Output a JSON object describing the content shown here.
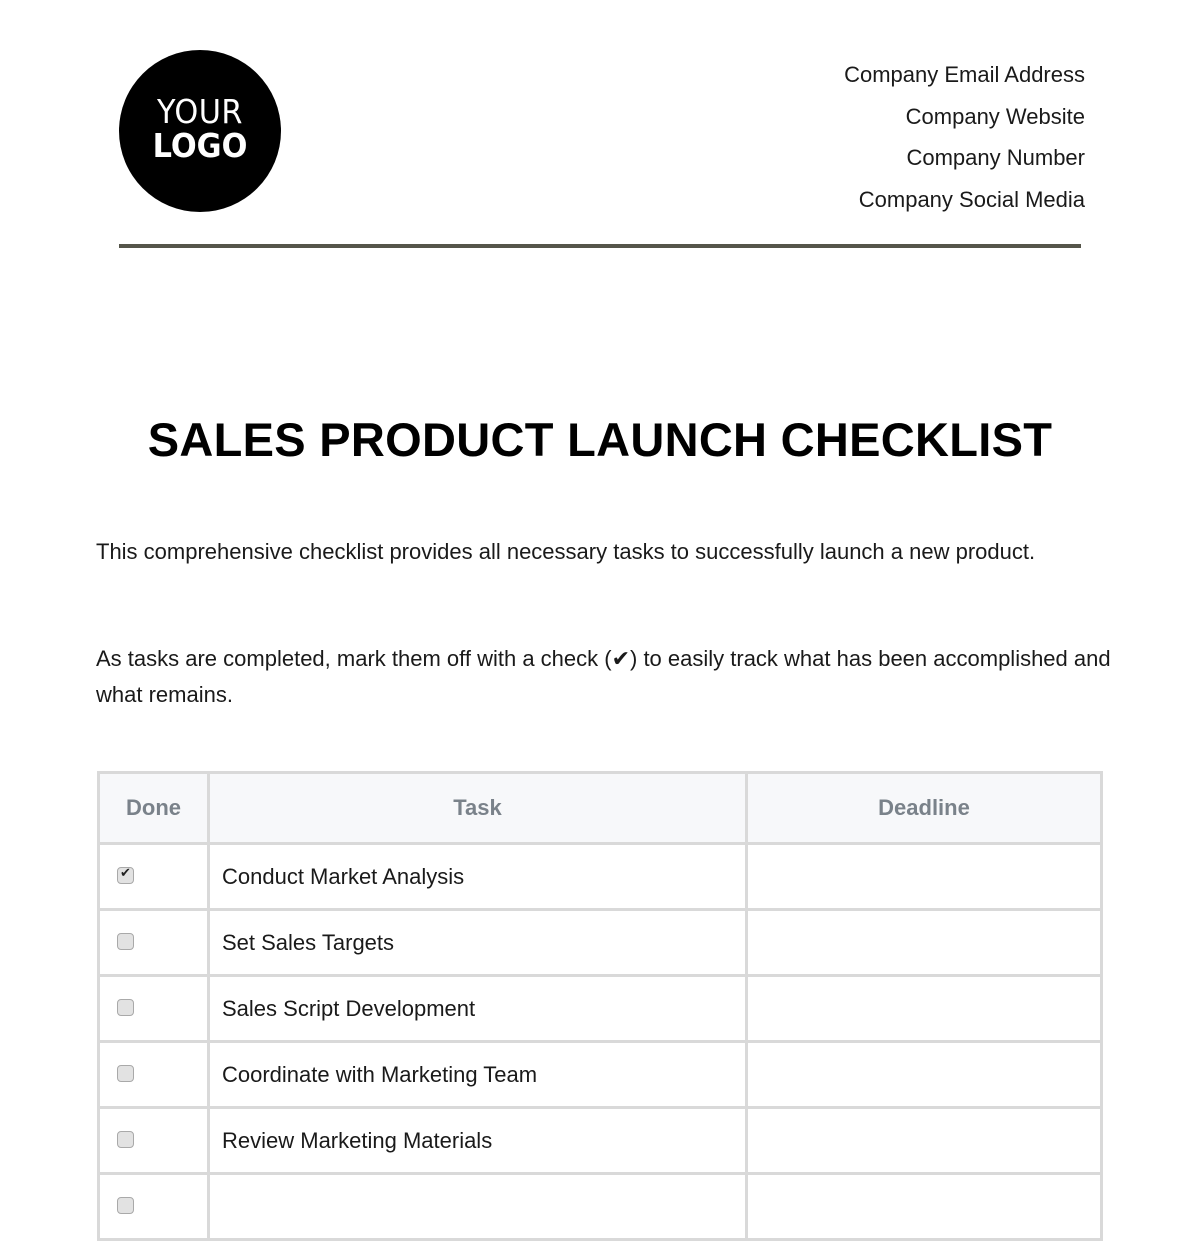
{
  "header": {
    "logo": {
      "line1": "YOUR",
      "line2": "LOGO"
    },
    "contact": [
      "Company Email Address",
      "Company Website",
      "Company Number",
      "Company Social Media"
    ],
    "divider_color": "#55554a"
  },
  "document": {
    "title": "SALES PRODUCT LAUNCH CHECKLIST",
    "paragraphs": [
      "This comprehensive checklist provides all necessary tasks to successfully launch a new product.",
      "As tasks are completed, mark them off with a check (✔) to easily track what has been accomplished and what remains."
    ]
  },
  "table": {
    "headers": [
      "Done",
      "Task",
      "Deadline"
    ],
    "rows": [
      {
        "done": true,
        "task": "Conduct Market Analysis",
        "deadline": ""
      },
      {
        "done": false,
        "task": "Set Sales Targets",
        "deadline": ""
      },
      {
        "done": false,
        "task": "Sales Script Development",
        "deadline": ""
      },
      {
        "done": false,
        "task": "Coordinate with Marketing Team",
        "deadline": ""
      },
      {
        "done": false,
        "task": "Review Marketing Materials",
        "deadline": ""
      },
      {
        "done": false,
        "task": "",
        "deadline": ""
      }
    ]
  }
}
